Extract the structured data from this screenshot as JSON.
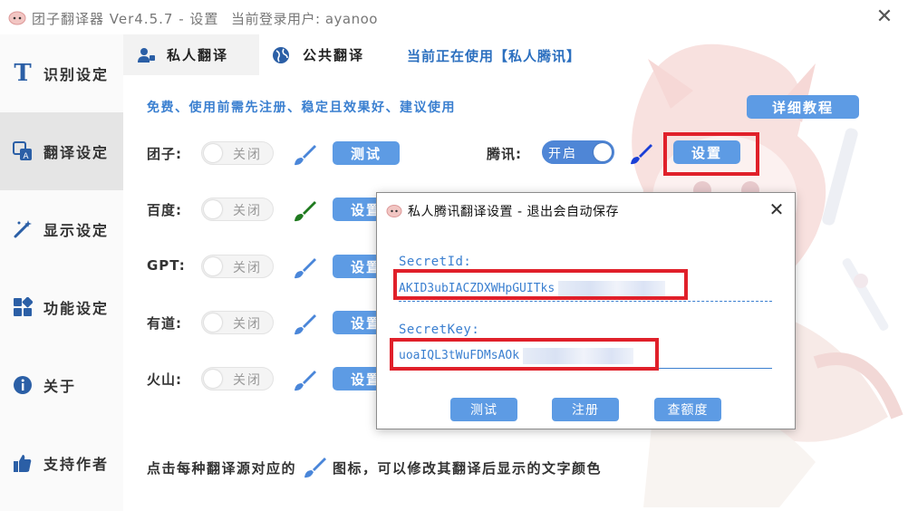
{
  "titlebar": {
    "app_title": "团子翻译器 Ver4.5.7 - 设置",
    "login_info": "当前登录用户: ayanoo",
    "close_glyph": "✕"
  },
  "sidebar": {
    "items": [
      {
        "label": "识别设定",
        "icon": "text-t-icon",
        "glyph": "T"
      },
      {
        "label": "翻译设定",
        "icon": "translate-icon",
        "glyph": "译"
      },
      {
        "label": "显示设定",
        "icon": "magic-wand-icon",
        "glyph": "✦"
      },
      {
        "label": "功能设定",
        "icon": "grid-icon",
        "glyph": "▦"
      },
      {
        "label": "关于",
        "icon": "info-icon",
        "glyph": "i"
      },
      {
        "label": "支持作者",
        "icon": "thumbs-up-icon",
        "glyph": "👍"
      }
    ]
  },
  "tabs": {
    "private": "私人翻译",
    "public": "公共翻译",
    "status": "当前正在使用【私人腾讯】"
  },
  "main": {
    "intro": "免费、使用前需先注册、稳定且效果好、建议使用",
    "tutorial_button": "详细教程",
    "engines": [
      {
        "label": "团子:",
        "switch": "关闭",
        "button": "测试",
        "brush_color": "#4a86d9"
      },
      {
        "label": "百度:",
        "switch": "关闭",
        "button": "设置",
        "brush_color": "#1f7a1f"
      },
      {
        "label": "GPT:",
        "switch": "关闭",
        "button": "设置",
        "brush_color": "#4a86d9"
      },
      {
        "label": "有道:",
        "switch": "关闭",
        "button": "设置",
        "brush_color": "#4a86d9"
      },
      {
        "label": "火山:",
        "switch": "关闭",
        "button": "设置",
        "brush_color": "#4a86d9"
      }
    ],
    "tencent": {
      "label": "腾讯:",
      "switch": "开启",
      "button": "设置",
      "brush_color": "#1a3fd6"
    },
    "note_before": "点击每种翻译源对应的",
    "note_after": "图标，可以修改其翻译后显示的文字颜色"
  },
  "dialog": {
    "title": "私人腾讯翻译设置 - 退出会自动保存",
    "close_glyph": "✕",
    "secret_id_label": "SecretId:",
    "secret_id_value": "AKID3ubIACZDXWHpGUITks",
    "secret_key_label": "SecretKey:",
    "secret_key_value": "uoaIQL3tWuFDMsAOk",
    "buttons": {
      "test": "测试",
      "register": "注册",
      "quota": "查额度"
    }
  },
  "colors": {
    "accent": "#5d9be4",
    "highlight": "#e0202a",
    "link_text": "#3a7fd0"
  }
}
